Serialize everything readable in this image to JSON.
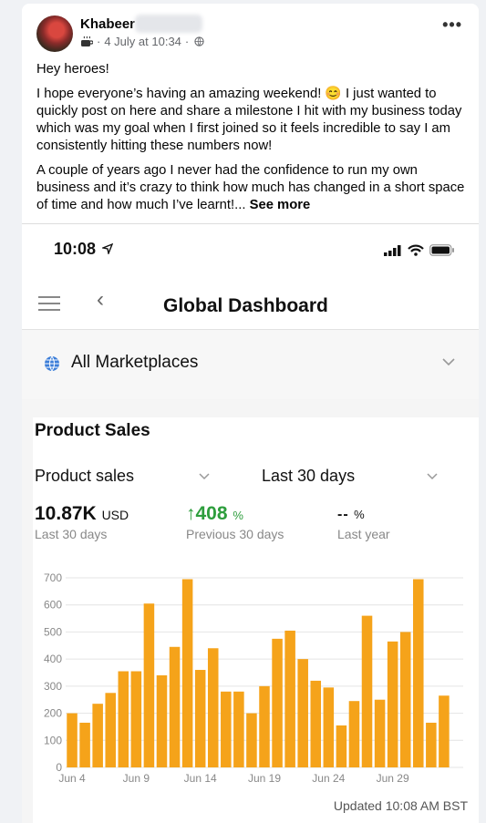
{
  "post": {
    "author": "Khabeer",
    "timestamp": "4 July at 10:34",
    "paragraphs": [
      "Hey heroes!",
      "I hope everyone’s having an amazing weekend! 😊 I just wanted to quickly post on here and share a milestone I hit with my business today which was my goal when I first joined so it feels incredible to say I am consistently hitting these numbers now!",
      "A couple of years ago I never had the confidence to run my own business and it’s crazy to think how much has changed in a short space of time and how much I’ve learnt!..."
    ],
    "see_more": "See more",
    "more_icon": "more-dots-icon"
  },
  "phone": {
    "time": "10:08",
    "nav_title": "Global Dashboard",
    "marketplace": "All Marketplaces",
    "section_title": "Product Sales",
    "dropdown_metric": "Product sales",
    "dropdown_range": "Last 30 days",
    "metric_value": "10.87K",
    "metric_unit": "USD",
    "metric_label": "Last 30 days",
    "change_arrow": "↑",
    "change_value": "408",
    "change_unit": "%",
    "change_label": "Previous 30 days",
    "yoy_value": "--",
    "yoy_unit": "%",
    "yoy_label": "Last year",
    "updated": "Updated 10:08 AM BST"
  },
  "colors": {
    "bar": "#f5a31a",
    "positive": "#2e9e3d"
  },
  "chart_data": {
    "type": "bar",
    "categories": [
      "Jun 4",
      "Jun 5",
      "Jun 6",
      "Jun 7",
      "Jun 8",
      "Jun 9",
      "Jun 10",
      "Jun 11",
      "Jun 12",
      "Jun 13",
      "Jun 14",
      "Jun 15",
      "Jun 16",
      "Jun 17",
      "Jun 18",
      "Jun 19",
      "Jun 20",
      "Jun 21",
      "Jun 22",
      "Jun 23",
      "Jun 24",
      "Jun 25",
      "Jun 26",
      "Jun 27",
      "Jun 28",
      "Jun 29",
      "Jun 30",
      "Jul 1",
      "Jul 2",
      "Jul 3",
      "Jul 4"
    ],
    "x_tick_labels": [
      "Jun 4",
      "Jun 9",
      "Jun 14",
      "Jun 19",
      "Jun 24",
      "Jun 29"
    ],
    "values": [
      200,
      165,
      235,
      275,
      355,
      355,
      605,
      340,
      445,
      695,
      360,
      440,
      280,
      280,
      200,
      300,
      475,
      505,
      400,
      320,
      295,
      155,
      245,
      560,
      250,
      465,
      500,
      695,
      165,
      265,
      0
    ],
    "yticks": [
      0,
      100,
      200,
      300,
      400,
      500,
      600,
      700
    ],
    "ylim": [
      0,
      700
    ],
    "title": "",
    "xlabel": "",
    "ylabel": "",
    "grid": true
  }
}
